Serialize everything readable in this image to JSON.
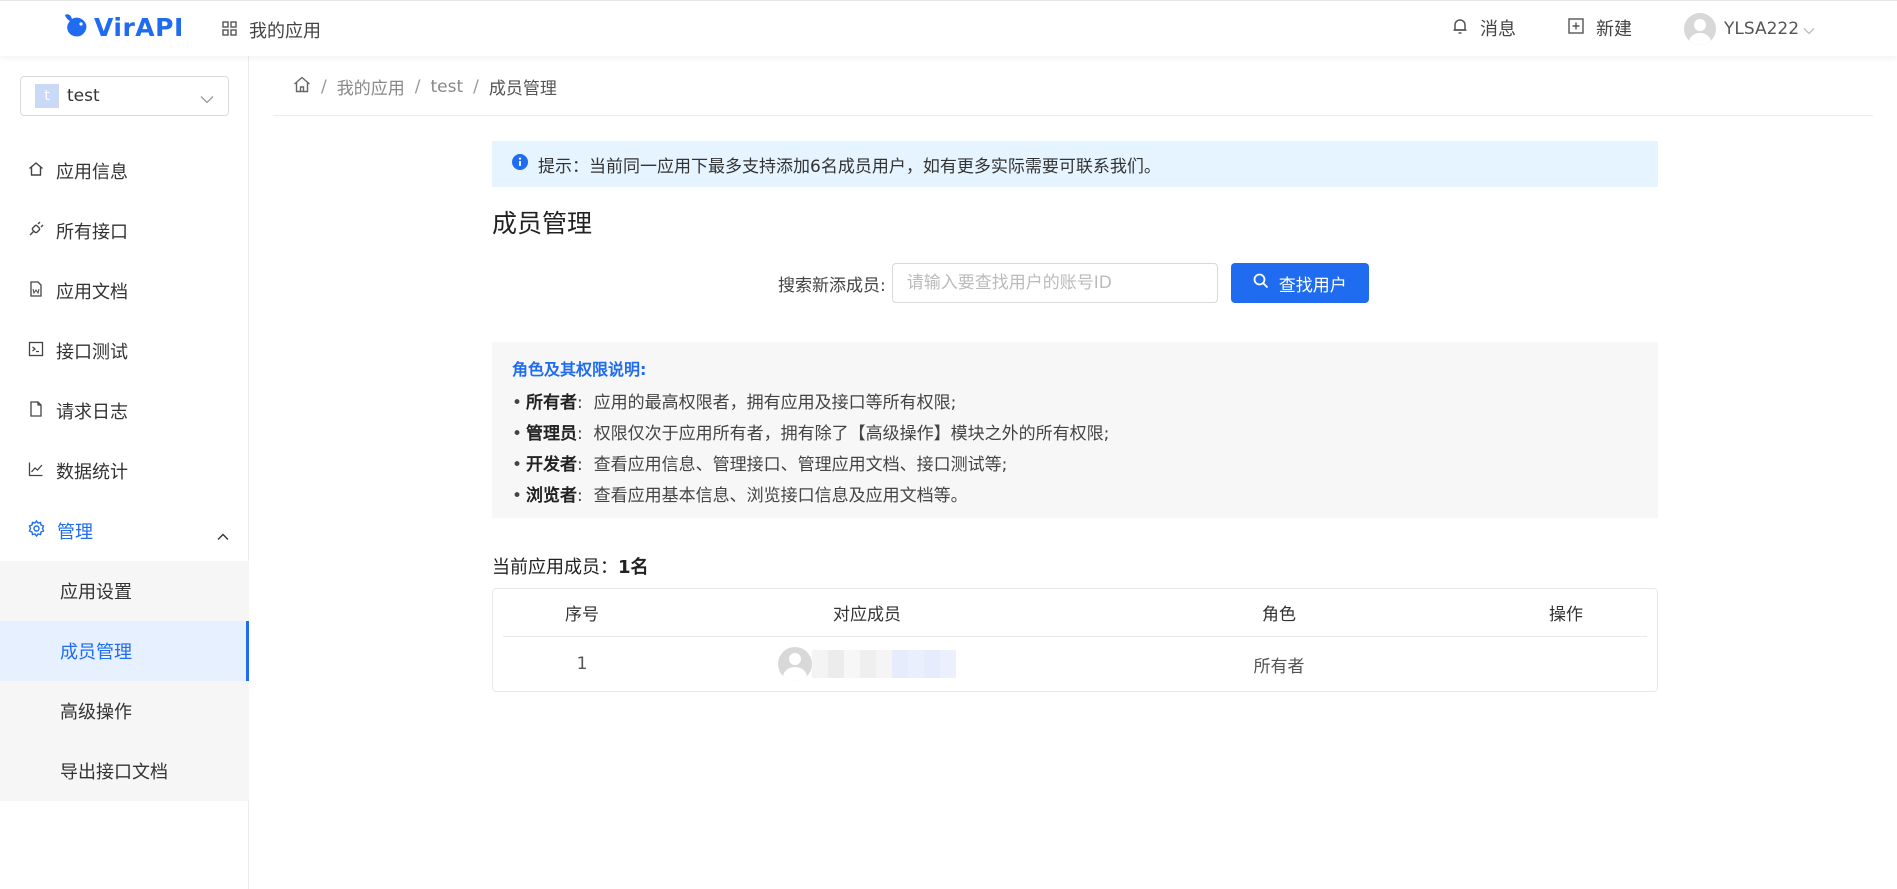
{
  "header": {
    "logo_text": "VirAPI",
    "my_apps": "我的应用",
    "messages": "消息",
    "new": "新建",
    "user_name": "YLSA222"
  },
  "sidebar": {
    "app_badge": "t",
    "app_name": "test",
    "items": [
      {
        "label": "应用信息",
        "icon": "home-icon"
      },
      {
        "label": "所有接口",
        "icon": "plug-icon"
      },
      {
        "label": "应用文档",
        "icon": "word-doc-icon"
      },
      {
        "label": "接口测试",
        "icon": "terminal-icon"
      },
      {
        "label": "请求日志",
        "icon": "file-icon"
      },
      {
        "label": "数据统计",
        "icon": "line-chart-icon"
      }
    ],
    "manage": {
      "label": "管理",
      "icon": "gear-icon",
      "children": [
        "应用设置",
        "成员管理",
        "高级操作",
        "导出接口文档"
      ]
    }
  },
  "breadcrumb": {
    "items": [
      "我的应用",
      "test"
    ],
    "current": "成员管理"
  },
  "tip": "提示：当前同一应用下最多支持添加6名成员用户，如有更多实际需要可联系我们。",
  "page_title": "成员管理",
  "search": {
    "label": "搜索新添成员:",
    "placeholder": "请输入要查找用户的账号ID",
    "value": "",
    "button": "查找用户"
  },
  "roles": {
    "title": "角色及其权限说明:",
    "lines": [
      {
        "name": "所有者",
        "desc": "应用的最高权限者，拥有应用及接口等所有权限;"
      },
      {
        "name": "管理员",
        "desc": "权限仅次于应用所有者，拥有除了【高级操作】模块之外的所有权限;"
      },
      {
        "name": "开发者",
        "desc": "查看应用信息、管理接口、管理应用文档、接口测试等;"
      },
      {
        "name": "浏览者",
        "desc": "查看应用基本信息、浏览接口信息及应用文档等。"
      }
    ]
  },
  "members": {
    "count_label": "当前应用成员：",
    "count_value": "1名",
    "columns": [
      "序号",
      "对应成员",
      "角色",
      "操作"
    ],
    "rows": [
      {
        "index": "1",
        "role": "所有者",
        "action": ""
      }
    ]
  },
  "colors": {
    "primary": "#1f6cf0",
    "tip_bg": "#e6f4ff",
    "active_bg": "#e6f0fe"
  }
}
